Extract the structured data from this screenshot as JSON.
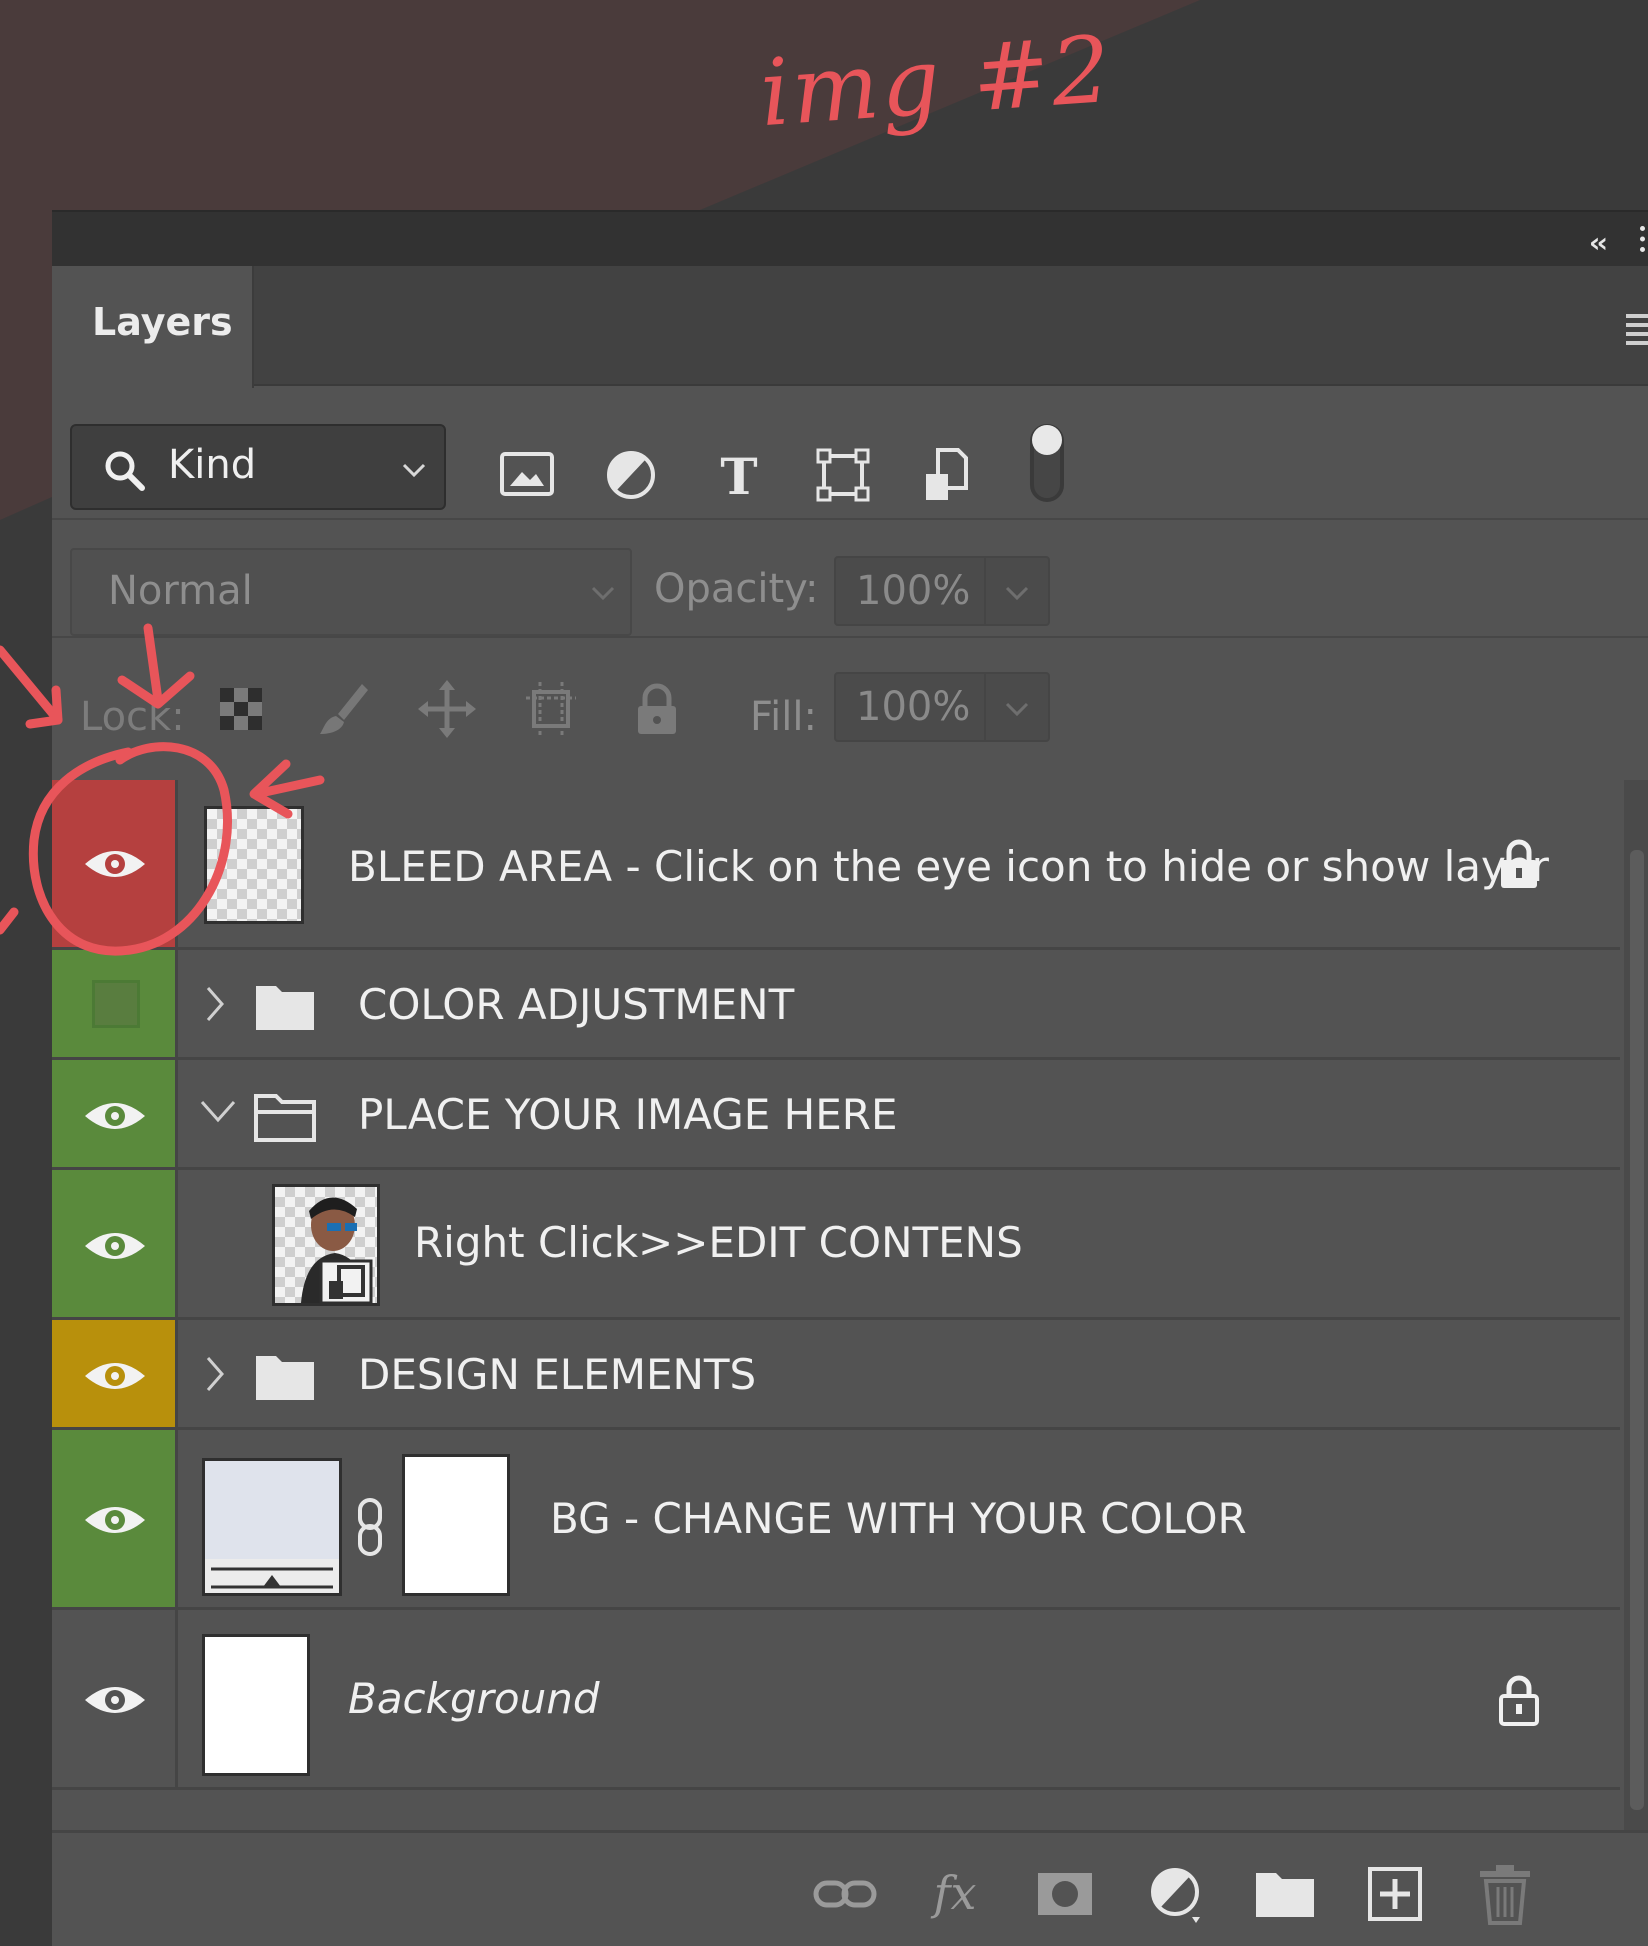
{
  "annotation": {
    "handwritten_label": "img #2"
  },
  "colors": {
    "accent_red": "#e8555a",
    "tag_red": "#b5403f",
    "tag_green": "#5a8a3c",
    "tag_yellow": "#b8900c",
    "panel_bg": "#535353"
  },
  "panel": {
    "collapse_icon": "double-chevron-left-icon",
    "tab_label": "Layers",
    "menu_icon": "panel-menu-icon"
  },
  "filter": {
    "kind_label": "Kind",
    "icons": [
      "pixel-layer-filter-icon",
      "adjustment-layer-filter-icon",
      "type-layer-filter-icon",
      "shape-layer-filter-icon",
      "smart-object-filter-icon",
      "filter-toggle-icon"
    ]
  },
  "blend": {
    "mode": "Normal",
    "opacity_label": "Opacity:",
    "opacity_value": "100%"
  },
  "lock": {
    "label": "Lock:",
    "fill_label": "Fill:",
    "fill_value": "100%",
    "icons": [
      "lock-transparent-pixels-icon",
      "lock-image-pixels-icon",
      "lock-position-icon",
      "lock-artboard-icon",
      "lock-all-icon"
    ]
  },
  "layers": [
    {
      "name": "BLEED AREA - Click on the eye icon to hide or show layer",
      "visible": true,
      "tag": "red",
      "locked": true
    },
    {
      "name": "COLOR ADJUSTMENT",
      "visible": false,
      "tag": "green",
      "group": true,
      "expanded": false
    },
    {
      "name": "PLACE YOUR IMAGE HERE",
      "visible": true,
      "tag": "green",
      "group": true,
      "expanded": true
    },
    {
      "name": "Right Click>>EDIT CONTENS",
      "visible": true,
      "tag": "green",
      "smart_object": true
    },
    {
      "name": "DESIGN ELEMENTS",
      "visible": true,
      "tag": "yellow",
      "group": true,
      "expanded": false
    },
    {
      "name": "BG - CHANGE WITH YOUR COLOR",
      "visible": true,
      "tag": "green",
      "has_mask": true
    },
    {
      "name": "Background",
      "visible": true,
      "tag": "none",
      "locked": true
    }
  ],
  "bottom_toolbar": {
    "icons": [
      "link-layers-icon",
      "fx-icon",
      "add-mask-icon",
      "new-adjustment-icon",
      "new-group-icon",
      "new-layer-icon",
      "delete-layer-icon"
    ]
  }
}
